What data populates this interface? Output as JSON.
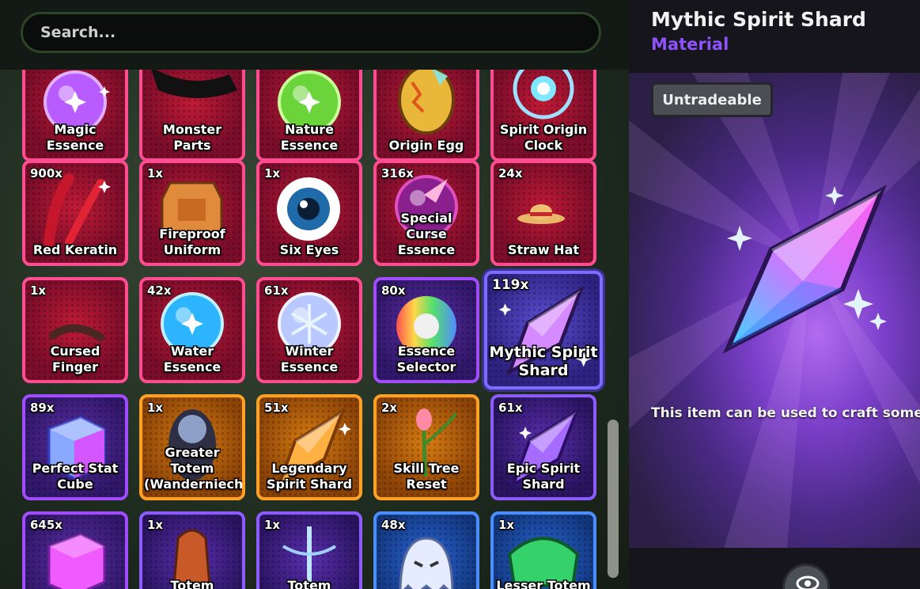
{
  "search": {
    "placeholder": "Search..."
  },
  "items": [
    {
      "name": "Magic Essence",
      "count": "",
      "rarity": "red",
      "icon": "magic-essence-icon"
    },
    {
      "name": "Monster Parts",
      "count": "",
      "rarity": "red",
      "icon": "monster-parts-icon"
    },
    {
      "name": "Nature Essence",
      "count": "",
      "rarity": "red",
      "icon": "nature-essence-icon"
    },
    {
      "name": "Origin Egg",
      "count": "",
      "rarity": "red",
      "icon": "origin-egg-icon"
    },
    {
      "name": "Spirit Origin Clock",
      "count": "",
      "rarity": "red",
      "icon": "spirit-origin-clock-icon"
    },
    {
      "name": "Red Keratin",
      "count": "900x",
      "rarity": "red",
      "icon": "red-keratin-icon"
    },
    {
      "name": "Fireproof Uniform",
      "count": "1x",
      "rarity": "red",
      "icon": "fireproof-uniform-icon"
    },
    {
      "name": "Six Eyes",
      "count": "1x",
      "rarity": "red",
      "icon": "six-eyes-icon"
    },
    {
      "name": "Special Curse Essence",
      "count": "316x",
      "rarity": "red",
      "icon": "special-curse-essence-icon"
    },
    {
      "name": "Straw Hat",
      "count": "24x",
      "rarity": "red",
      "icon": "straw-hat-icon"
    },
    {
      "name": "Cursed Finger",
      "count": "1x",
      "rarity": "red",
      "icon": "cursed-finger-icon"
    },
    {
      "name": "Water Essence",
      "count": "42x",
      "rarity": "red",
      "icon": "water-essence-icon"
    },
    {
      "name": "Winter Essence",
      "count": "61x",
      "rarity": "red",
      "icon": "winter-essence-icon"
    },
    {
      "name": "Essence Selector",
      "count": "80x",
      "rarity": "purple",
      "icon": "essence-selector-icon"
    },
    {
      "name": "Mythic Spirit Shard",
      "count": "119x",
      "rarity": "selected",
      "icon": "mythic-spirit-shard-icon"
    },
    {
      "name": "Perfect Stat Cube",
      "count": "89x",
      "rarity": "purple",
      "icon": "perfect-stat-cube-icon"
    },
    {
      "name": "Greater Totem (Wanderniech)",
      "count": "1x",
      "rarity": "orange",
      "icon": "greater-totem-icon"
    },
    {
      "name": "Legendary Spirit Shard",
      "count": "51x",
      "rarity": "orange",
      "icon": "legendary-spirit-shard-icon"
    },
    {
      "name": "Skill Tree Reset",
      "count": "2x",
      "rarity": "orange",
      "icon": "skill-tree-reset-icon"
    },
    {
      "name": "Epic Spirit Shard",
      "count": "61x",
      "rarity": "purple2",
      "icon": "epic-spirit-shard-icon"
    },
    {
      "name": "",
      "count": "645x",
      "rarity": "purple",
      "icon": "pink-cube-icon"
    },
    {
      "name": "Totem (Central",
      "count": "1x",
      "rarity": "purple2",
      "icon": "totem-central-icon"
    },
    {
      "name": "Totem (Wanderniec",
      "count": "1x",
      "rarity": "purple2",
      "icon": "totem-wanderniec-icon"
    },
    {
      "name": "",
      "count": "48x",
      "rarity": "blue",
      "icon": "ghost-icon"
    },
    {
      "name": "Lesser Totem (Ancient",
      "count": "1x",
      "rarity": "blue",
      "icon": "lesser-totem-icon"
    }
  ],
  "detail": {
    "title": "Mythic Spirit Shard",
    "type": "Material",
    "badge": "Untradeable",
    "description": "This item can be used to craft someth",
    "type_color": "#8e53ff"
  }
}
